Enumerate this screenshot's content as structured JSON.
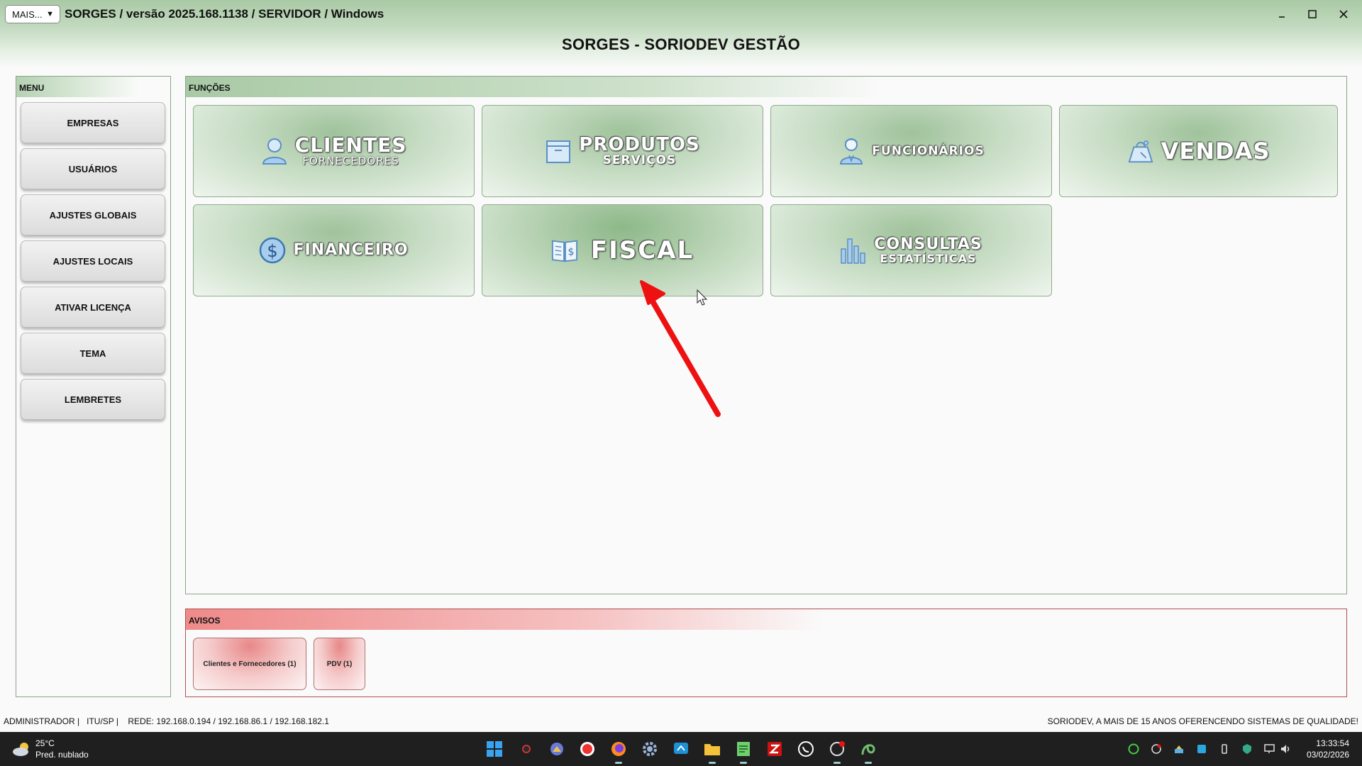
{
  "titlebar": {
    "mais_label": "MAIS...",
    "mais_caret": "▼",
    "title": "SORGES / versão 2025.168.1138 / SERVIDOR / Windows"
  },
  "app_title": "SORGES - SORIODEV GESTÃO",
  "menu": {
    "header": "MENU",
    "items": [
      {
        "label": "EMPRESAS"
      },
      {
        "label": "USUÁRIOS"
      },
      {
        "label": "AJUSTES GLOBAIS"
      },
      {
        "label": "AJUSTES LOCAIS"
      },
      {
        "label": "ATIVAR LICENÇA"
      },
      {
        "label": "TEMA"
      },
      {
        "label": "LEMBRETES"
      }
    ]
  },
  "functions": {
    "header": "FUNÇÕES",
    "clientes": {
      "main": "CLIENTES",
      "sub": "FORNECEDORES",
      "icon": "person-icon"
    },
    "produtos": {
      "main": "PRODUTOS",
      "sub": "SERVIÇOS",
      "icon": "box-icon"
    },
    "funcionarios": {
      "main": "FUNCIONÁRIOS",
      "icon": "employee-icon"
    },
    "vendas": {
      "main": "VENDAS",
      "icon": "scale-icon"
    },
    "financeiro": {
      "main": "FINANCEIRO",
      "icon": "dollar-icon"
    },
    "fiscal": {
      "main": "FISCAL",
      "icon": "ledger-icon"
    },
    "consultas": {
      "main": "CONSULTAS",
      "sub": "ESTATÍSTICAS",
      "icon": "bar-chart-icon"
    }
  },
  "avisos": {
    "header": "AVISOS",
    "items": [
      {
        "label": "Clientes e Fornecedores (1)"
      },
      {
        "label": "PDV (1)"
      }
    ]
  },
  "status": {
    "left": "ADMINISTRADOR |   ITU/SP |    REDE: 192.168.0.194 / 192.168.86.1 / 192.168.182.1",
    "right": "SORIODEV, A MAIS DE 15 ANOS OFERENCENDO SISTEMAS DE QUALIDADE!"
  },
  "taskbar": {
    "weather_temp": "25°C",
    "weather_desc": "Pred. nublado",
    "time": "13:33:54",
    "date": "03/02/2026"
  },
  "colors": {
    "accent_green": "#a9c9a5",
    "alert_red": "#ef8a8a",
    "arrow_red": "#ee1111",
    "taskbar": "#1f1f1f"
  }
}
